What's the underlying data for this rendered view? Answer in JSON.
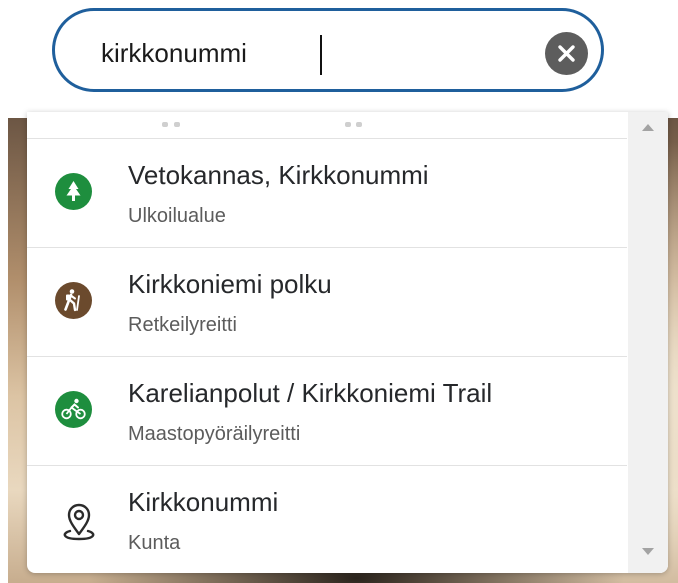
{
  "search": {
    "value": "kirkkonummi",
    "clear_label": "✕"
  },
  "results": [
    {
      "title": "Vetokannas, Kirkkonummi",
      "subtitle": "Ulkoilualue",
      "icon": "tree-icon",
      "icon_color": "#1e8e3e"
    },
    {
      "title": "Kirkkoniemi polku",
      "subtitle": "Retkeilyreitti",
      "icon": "hiker-icon",
      "icon_color": "#6b4a2d"
    },
    {
      "title": "Karelianpolut / Kirkkoniemi Trail",
      "subtitle": "Maastopyöräilyreitti",
      "icon": "bicycle-icon",
      "icon_color": "#1e8e3e"
    },
    {
      "title": "Kirkkonummi",
      "subtitle": "Kunta",
      "icon": "map-pin-icon",
      "icon_color": "#2b2b2b"
    }
  ],
  "colors": {
    "search_border": "#1f5f9c",
    "clear_button": "#5d5d5d",
    "title_text": "#26282b",
    "subtitle_text": "#5c5c5c"
  }
}
